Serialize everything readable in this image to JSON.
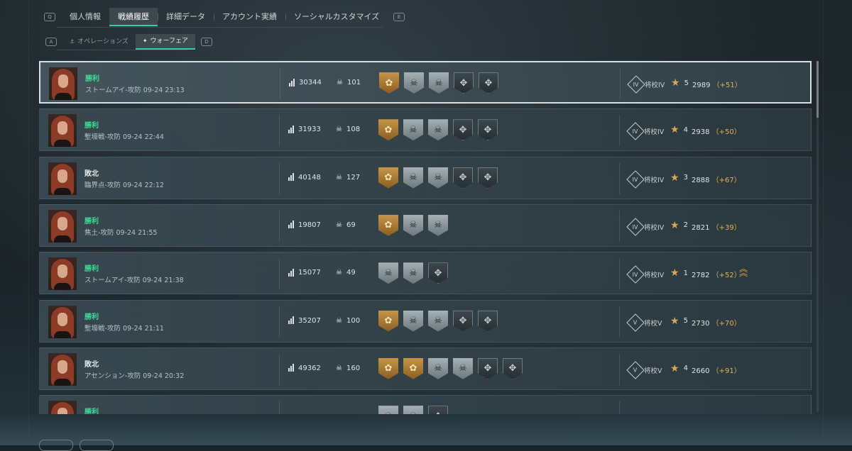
{
  "header": {
    "tabs": [
      {
        "label": "個人情報",
        "active": false
      },
      {
        "label": "戦績履歴",
        "active": true
      },
      {
        "label": "詳細データ",
        "active": false
      },
      {
        "label": "アカウント実績",
        "active": false
      },
      {
        "label": "ソーシャルカスタマイズ",
        "active": false
      }
    ],
    "left_key": "Q",
    "right_key": "E"
  },
  "subtabs": {
    "items": [
      {
        "label": "オペレーションズ",
        "active": false
      },
      {
        "label": "ウォーフェア",
        "active": true
      }
    ],
    "left_key": "A",
    "right_key": "D"
  },
  "colors": {
    "accent": "#2fd3a0",
    "win": "#3ddc97",
    "delta": "#e0b257"
  },
  "matches": [
    {
      "result": "勝利",
      "win": true,
      "detail": "ストームアイ-攻防 09-24 23:13",
      "score": "30344",
      "kills": "101",
      "medals": [
        "gold",
        "silver",
        "silver",
        "dark",
        "dark"
      ],
      "rank": "将校IV",
      "tier": "IV",
      "stars": "5",
      "points": "2989",
      "delta": "（+51）",
      "promote": false
    },
    {
      "result": "勝利",
      "win": true,
      "detail": "塹壕戦-攻防 09-24 22:44",
      "score": "31933",
      "kills": "108",
      "medals": [
        "gold",
        "silver",
        "silver",
        "dark",
        "dark"
      ],
      "rank": "将校IV",
      "tier": "IV",
      "stars": "4",
      "points": "2938",
      "delta": "（+50）",
      "promote": false
    },
    {
      "result": "敗北",
      "win": false,
      "detail": "臨界点-攻防 09-24 22:12",
      "score": "40148",
      "kills": "127",
      "medals": [
        "gold",
        "silver",
        "silver",
        "dark",
        "dark"
      ],
      "rank": "将校IV",
      "tier": "IV",
      "stars": "3",
      "points": "2888",
      "delta": "（+67）",
      "promote": false
    },
    {
      "result": "勝利",
      "win": true,
      "detail": "焦土-攻防 09-24 21:55",
      "score": "19807",
      "kills": "69",
      "medals": [
        "gold",
        "silver",
        "silver"
      ],
      "rank": "将校IV",
      "tier": "IV",
      "stars": "2",
      "points": "2821",
      "delta": "（+39）",
      "promote": false
    },
    {
      "result": "勝利",
      "win": true,
      "detail": "ストームアイ-攻防 09-24 21:38",
      "score": "15077",
      "kills": "49",
      "medals": [
        "silver",
        "silver",
        "dark"
      ],
      "rank": "将校IV",
      "tier": "IV",
      "stars": "1",
      "points": "2782",
      "delta": "（+52）",
      "promote": true
    },
    {
      "result": "勝利",
      "win": true,
      "detail": "塹壕戦-攻防 09-24 21:11",
      "score": "35207",
      "kills": "100",
      "medals": [
        "gold",
        "silver",
        "silver",
        "dark",
        "dark"
      ],
      "rank": "将校V",
      "tier": "V",
      "stars": "5",
      "points": "2730",
      "delta": "（+70）",
      "promote": false
    },
    {
      "result": "敗北",
      "win": false,
      "detail": "アセンション-攻防 09-24 20:32",
      "score": "49362",
      "kills": "160",
      "medals": [
        "gold",
        "gold",
        "silver",
        "silver",
        "dark",
        "dark"
      ],
      "rank": "将校V",
      "tier": "V",
      "stars": "4",
      "points": "2660",
      "delta": "（+91）",
      "promote": false
    },
    {
      "result": "勝利",
      "win": true,
      "detail": "",
      "score": "",
      "kills": "",
      "medals": [
        "silver",
        "silver",
        "dark"
      ],
      "rank": "",
      "tier": "",
      "stars": "",
      "points": "",
      "delta": "",
      "promote": false
    }
  ],
  "icons": {
    "score": "bar-chart-icon",
    "kills": "skull-icon",
    "star": "star-icon",
    "rank": "rank-diamond-icon",
    "promote": "chevron-stack-icon"
  }
}
